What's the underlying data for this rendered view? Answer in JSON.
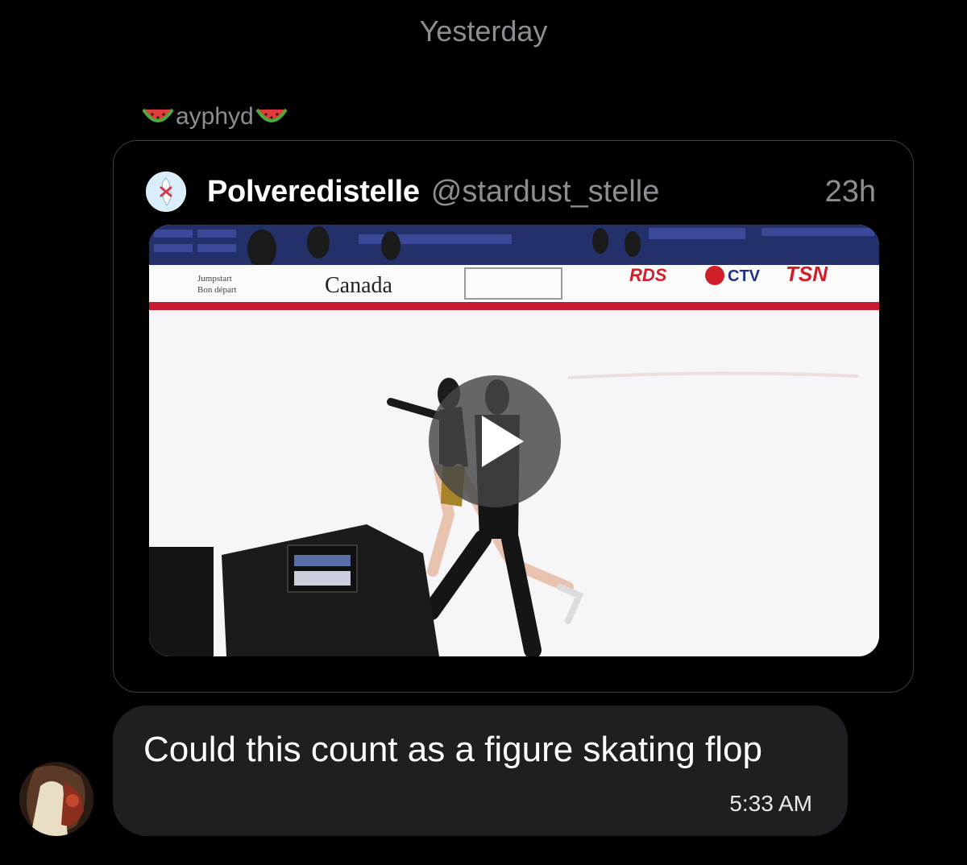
{
  "conversation": {
    "date_separator": "Yesterday",
    "sender_name": "ayphyd",
    "sender_decoration_icon": "watermelon-icon"
  },
  "shared_tweet": {
    "display_name": "Polveredistelle",
    "handle": "@stardust_stelle",
    "time_ago": "23h",
    "media_type": "video",
    "board_ads": [
      "Jumpstart",
      "Bon départ",
      "Canada",
      "RDS",
      "CTV",
      "TSN"
    ]
  },
  "message": {
    "text": "Could this count as a figure skating flop",
    "timestamp": "5:33 AM"
  },
  "colors": {
    "background": "#000000",
    "bubble": "#1d1f22",
    "muted_text": "#8b8f94",
    "card_border": "#3a3d42"
  }
}
